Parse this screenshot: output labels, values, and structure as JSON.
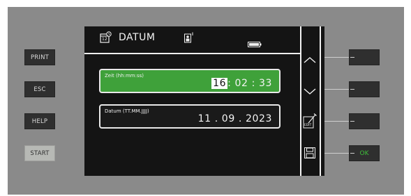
{
  "hardware_buttons": [
    "PRINT",
    "ESC",
    "HELP",
    "START"
  ],
  "header": {
    "title": "DATUM",
    "calendar_icon_text": "12"
  },
  "fields": [
    {
      "label": "Zeit (hh:mm:ss)",
      "value_highlight": "16",
      "value_rest": ": 02 : 33",
      "active": true
    },
    {
      "label": "Datum (TT.MM.JJJJ)",
      "value": "11 . 09 . 2023",
      "active": false
    }
  ],
  "softkeys": {
    "edit_label": "EDIT",
    "ok_label": "OK"
  },
  "colors": {
    "accent_green": "#3fa13a",
    "ok_text": "#3fbf3a",
    "screen_bg": "#141414",
    "device_bg": "#8a8a8a"
  }
}
